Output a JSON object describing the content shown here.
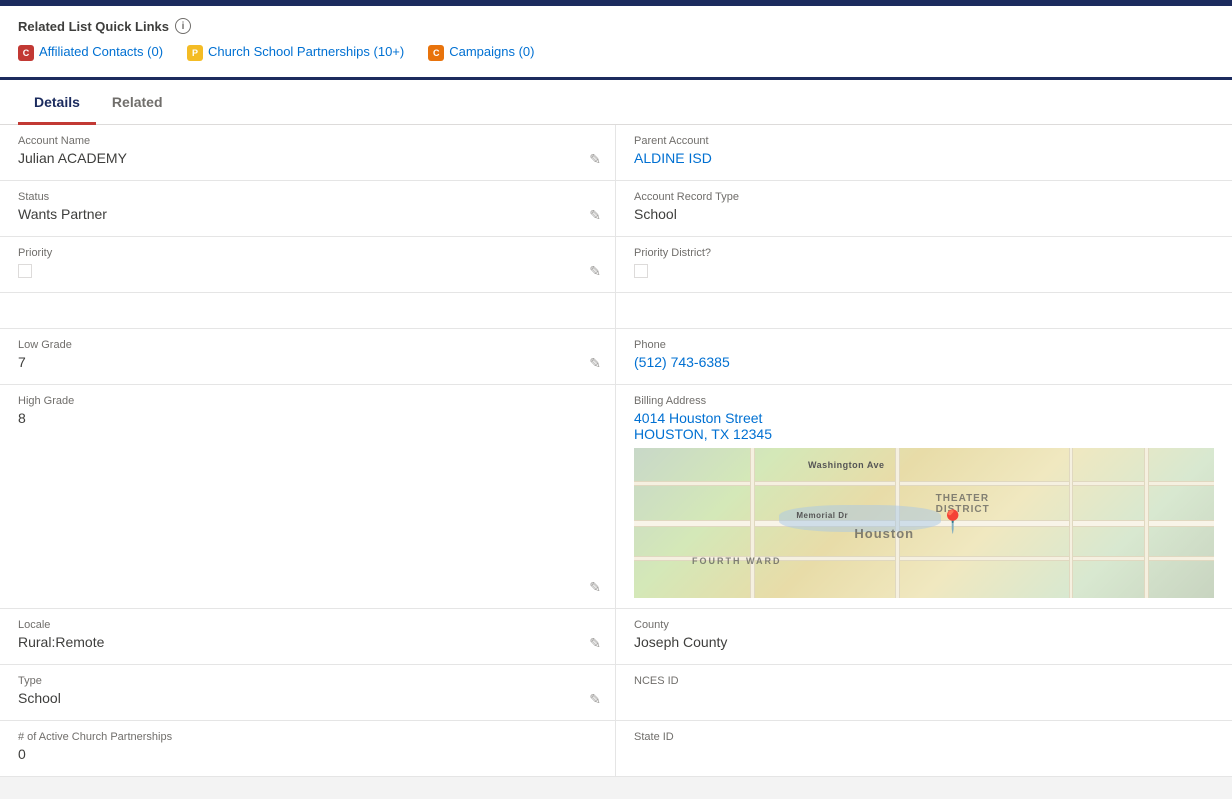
{
  "quick_links": {
    "title": "Related List Quick Links",
    "info_icon": "i",
    "items": [
      {
        "id": "affiliated-contacts",
        "icon_color": "red",
        "icon_letter": "C",
        "label": "Affiliated Contacts (0)"
      },
      {
        "id": "church-school-partnerships",
        "icon_color": "yellow",
        "icon_letter": "P",
        "label": "Church School Partnerships (10+)"
      },
      {
        "id": "campaigns",
        "icon_color": "orange",
        "icon_letter": "C",
        "label": "Campaigns (0)"
      }
    ]
  },
  "tabs": [
    {
      "id": "details",
      "label": "Details",
      "active": true
    },
    {
      "id": "related",
      "label": "Related",
      "active": false
    }
  ],
  "fields": {
    "account_name_label": "Account Name",
    "account_name_value": "Julian ACADEMY",
    "parent_account_label": "Parent Account",
    "parent_account_value": "ALDINE ISD",
    "status_label": "Status",
    "status_value": "Wants Partner",
    "account_record_type_label": "Account Record Type",
    "account_record_type_value": "School",
    "priority_label": "Priority",
    "priority_district_label": "Priority District?",
    "low_grade_label": "Low Grade",
    "low_grade_value": "7",
    "phone_label": "Phone",
    "phone_value": "(512) 743-6385",
    "high_grade_label": "High Grade",
    "high_grade_value": "8",
    "billing_address_label": "Billing Address",
    "billing_address_line1": "4014 Houston Street",
    "billing_address_line2": "HOUSTON, TX 12345",
    "locale_label": "Locale",
    "locale_value": "Rural:Remote",
    "county_label": "County",
    "county_value": "Joseph County",
    "type_label": "Type",
    "type_value": "School",
    "nces_id_label": "NCES ID",
    "nces_id_value": "",
    "active_partnerships_label": "# of Active Church Partnerships",
    "active_partnerships_value": "0",
    "state_id_label": "State ID",
    "state_id_value": "",
    "map_labels": {
      "theater_district": "THEATER DISTRICT",
      "houston": "Houston",
      "fourth_ward": "FOURTH WARD",
      "memorial_dr": "Memorial Dr",
      "washington_ave": "Washington Ave"
    }
  }
}
